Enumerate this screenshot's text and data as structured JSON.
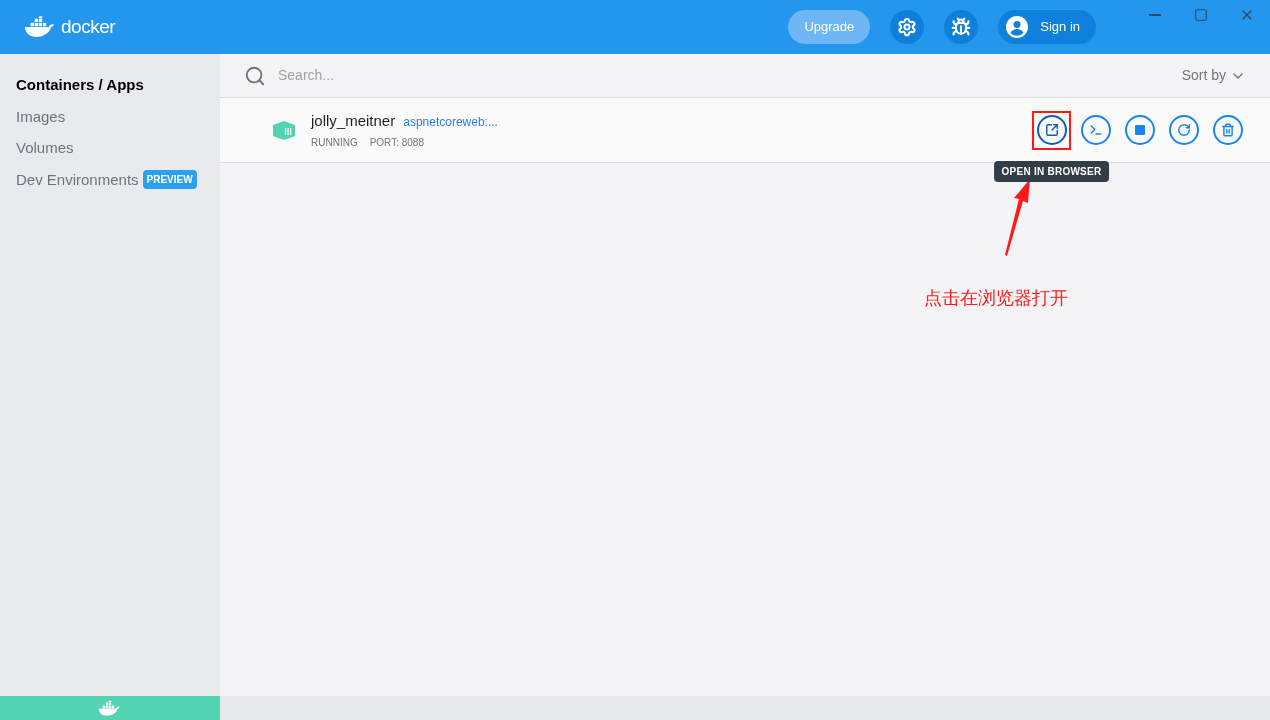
{
  "header": {
    "logo": "docker",
    "upgrade": "Upgrade",
    "sign_in": "Sign in"
  },
  "sidebar": {
    "items": [
      {
        "label": "Containers / Apps",
        "selected": true
      },
      {
        "label": "Images",
        "selected": false
      },
      {
        "label": "Volumes",
        "selected": false
      },
      {
        "label": "Dev Environments",
        "selected": false,
        "badge": "PREVIEW"
      }
    ]
  },
  "search": {
    "placeholder": "Search..."
  },
  "sort": {
    "label": "Sort by"
  },
  "containers": [
    {
      "name": "jolly_meitner",
      "image": "aspnetcoreweb:...",
      "status": "RUNNING",
      "port": "PORT: 8088",
      "actions": [
        {
          "kind": "open",
          "highlighted": true,
          "tooltip": "OPEN IN BROWSER"
        },
        {
          "kind": "cli",
          "highlighted": false
        },
        {
          "kind": "stop",
          "highlighted": false
        },
        {
          "kind": "restart",
          "highlighted": false
        },
        {
          "kind": "delete",
          "highlighted": false
        }
      ]
    }
  ],
  "annotation": {
    "text": "点击在浏览器打开"
  }
}
